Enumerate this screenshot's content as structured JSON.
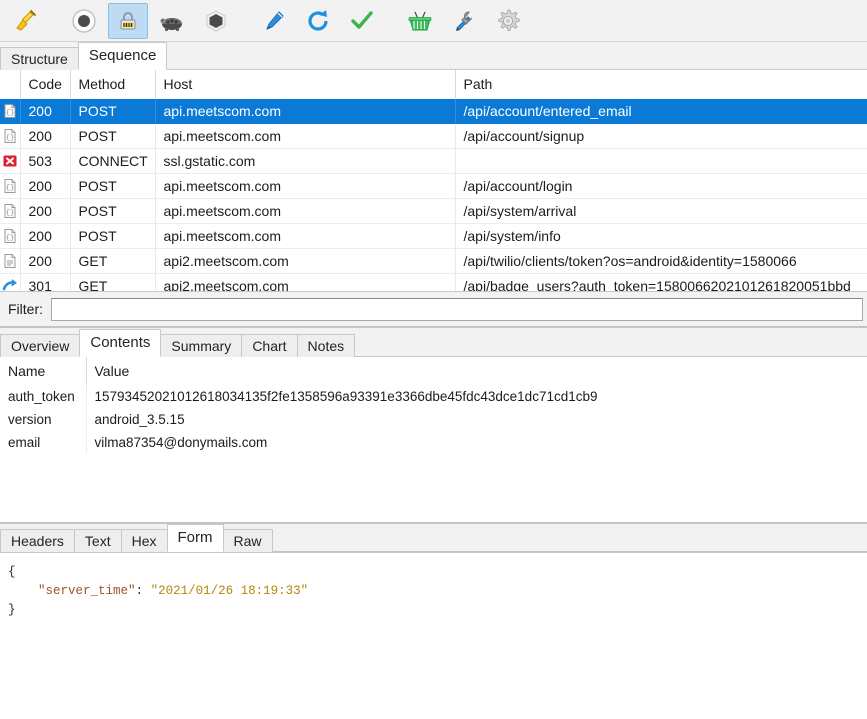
{
  "toolbar": {
    "buttons": [
      {
        "name": "clear-session-button",
        "icon": "broom-icon",
        "label": "Clear Session",
        "selected": false
      },
      {
        "name": "record-button",
        "icon": "record-icon",
        "label": "Start Recording",
        "selected": false
      },
      {
        "name": "ssl-proxying-button",
        "icon": "lock-icon",
        "label": "SSL Proxying",
        "selected": true
      },
      {
        "name": "throttle-button",
        "icon": "turtle-icon",
        "label": "Throttling",
        "selected": false
      },
      {
        "name": "breakpoints-button",
        "icon": "hexagon-stop-icon",
        "label": "Breakpoints",
        "selected": false
      },
      {
        "name": "compose-button",
        "icon": "pen-icon",
        "label": "Compose",
        "selected": false
      },
      {
        "name": "repeat-button",
        "icon": "refresh-icon",
        "label": "Repeat",
        "selected": false
      },
      {
        "name": "validate-button",
        "icon": "checkmark-icon",
        "label": "Validate",
        "selected": false
      },
      {
        "name": "publish-button",
        "icon": "basket-icon",
        "label": "Publish",
        "selected": false
      },
      {
        "name": "tools-button",
        "icon": "tools-icon",
        "label": "Tools",
        "selected": false
      },
      {
        "name": "settings-button",
        "icon": "gear-icon",
        "label": "Settings",
        "selected": false
      }
    ]
  },
  "top_tabs": [
    {
      "label": "Structure",
      "active": false
    },
    {
      "label": "Sequence",
      "active": true
    }
  ],
  "session_table": {
    "columns": [
      "",
      "Code",
      "Method",
      "Host",
      "Path"
    ],
    "rows": [
      {
        "icon": "document-icon",
        "code": "200",
        "method": "POST",
        "host": "api.meetscom.com",
        "path": "/api/account/entered_email",
        "selected": true
      },
      {
        "icon": "document-icon",
        "code": "200",
        "method": "POST",
        "host": "api.meetscom.com",
        "path": "/api/account/signup",
        "selected": false
      },
      {
        "icon": "error-icon",
        "code": "503",
        "method": "CONNECT",
        "host": "ssl.gstatic.com",
        "path": "",
        "selected": false
      },
      {
        "icon": "document-icon",
        "code": "200",
        "method": "POST",
        "host": "api.meetscom.com",
        "path": "/api/account/login",
        "selected": false
      },
      {
        "icon": "document-icon",
        "code": "200",
        "method": "POST",
        "host": "api.meetscom.com",
        "path": "/api/system/arrival",
        "selected": false
      },
      {
        "icon": "document-icon",
        "code": "200",
        "method": "POST",
        "host": "api.meetscom.com",
        "path": "/api/system/info",
        "selected": false
      },
      {
        "icon": "text-document-icon",
        "code": "200",
        "method": "GET",
        "host": "api2.meetscom.com",
        "path": "/api/twilio/clients/token?os=android&identity=1580066",
        "selected": false
      },
      {
        "icon": "redirect-icon",
        "code": "301",
        "method": "GET",
        "host": "api2.meetscom.com",
        "path": "/api/badge_users?auth_token=1580066202101261820051bbd",
        "selected": false
      }
    ]
  },
  "filter": {
    "label": "Filter:",
    "value": "",
    "placeholder": ""
  },
  "mid_tabs": [
    {
      "label": "Overview",
      "active": false
    },
    {
      "label": "Contents",
      "active": true
    },
    {
      "label": "Summary",
      "active": false
    },
    {
      "label": "Chart",
      "active": false
    },
    {
      "label": "Notes",
      "active": false
    }
  ],
  "name_value_table": {
    "columns": [
      "Name",
      "Value"
    ],
    "rows": [
      {
        "name": "auth_token",
        "value": "15793452021012618034135f2fe1358596a93391e3366dbe45fdc43dce1dc71cd1cb9"
      },
      {
        "name": "version",
        "value": "android_3.5.15"
      },
      {
        "name": "email",
        "value": "vilma87354@donymails.com"
      }
    ]
  },
  "bottom_tabs": [
    {
      "label": "Headers",
      "active": false
    },
    {
      "label": "Text",
      "active": false
    },
    {
      "label": "Hex",
      "active": false
    },
    {
      "label": "Form",
      "active": true
    },
    {
      "label": "Raw",
      "active": false
    }
  ],
  "body_viewer": {
    "open_brace": "{",
    "key": "\"server_time\"",
    "colon": ":",
    "value": "\"2021/01/26 18:19:33\"",
    "close_brace": "}"
  },
  "colors": {
    "selection_blue": "#0b7ad6",
    "toolbar_bg": "#f2f2f2",
    "selected_tool_bg": "#bcdcf4",
    "json_key": "#a0522d",
    "json_string": "#b8860b",
    "error_red": "#d9232e"
  }
}
